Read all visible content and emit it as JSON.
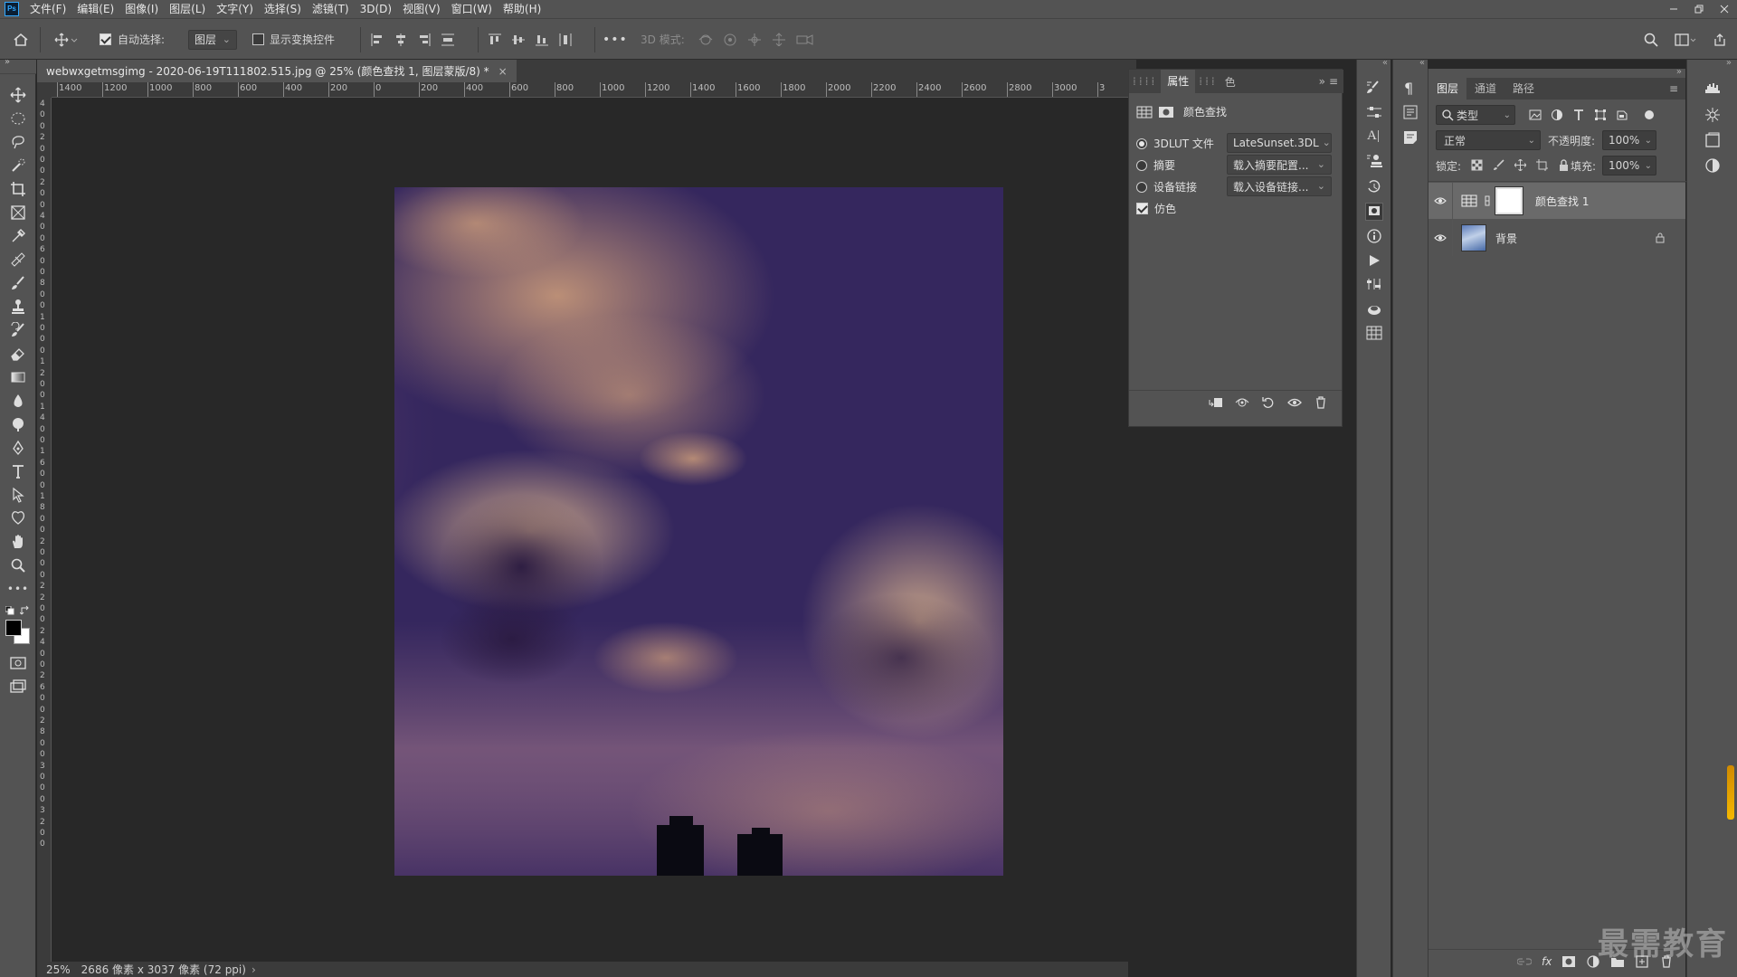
{
  "menubar": {
    "app_icon": "Ps",
    "items": [
      "文件(F)",
      "编辑(E)",
      "图像(I)",
      "图层(L)",
      "文字(Y)",
      "选择(S)",
      "滤镜(T)",
      "3D(D)",
      "视图(V)",
      "窗口(W)",
      "帮助(H)"
    ],
    "window_controls": [
      "minimize-icon",
      "restore-icon",
      "close-icon"
    ]
  },
  "options": {
    "auto_select_label": "自动选择:",
    "auto_select_checked": true,
    "auto_select_target": "图层",
    "show_transform_label": "显示变换控件",
    "show_transform_checked": false,
    "more": "•••",
    "mode3d_label": "3D 模式:"
  },
  "document": {
    "tab_title": "webwxgetmsgimg - 2020-06-19T111802.515.jpg @ 25% (颜色查找 1, 图层蒙版/8) *",
    "close": "×"
  },
  "rulers": {
    "h_ticks": [
      "1400",
      "1200",
      "1000",
      "800",
      "600",
      "400",
      "200",
      "0",
      "200",
      "400",
      "600",
      "800",
      "1000",
      "1200",
      "1400",
      "1600",
      "1800",
      "2000",
      "2200",
      "2400",
      "2600",
      "2800",
      "3000",
      "3"
    ],
    "v_ticks": [
      "4",
      "0",
      "0",
      "2",
      "0",
      "0",
      "0",
      "2",
      "0",
      "0",
      "4",
      "0",
      "0",
      "6",
      "0",
      "0",
      "8",
      "0",
      "0",
      "1",
      "0",
      "0",
      "0",
      "1",
      "2",
      "0",
      "0",
      "1",
      "4",
      "0",
      "0",
      "1",
      "6",
      "0",
      "0",
      "1",
      "8",
      "0",
      "0",
      "2",
      "0",
      "0",
      "0",
      "2",
      "2",
      "0",
      "0",
      "2",
      "4",
      "0",
      "0",
      "2",
      "6",
      "0",
      "0",
      "2",
      "8",
      "0",
      "0",
      "3",
      "0",
      "0",
      "0",
      "3",
      "2",
      "0",
      "0"
    ]
  },
  "status": {
    "zoom": "25%",
    "info": "2686 像素 x 3037 像素 (72 ppi)"
  },
  "properties": {
    "tabs": [
      "属性",
      "色"
    ],
    "active_tab": "属性",
    "header": "颜色查找",
    "rows": [
      {
        "type": "radio",
        "label": "3DLUT 文件",
        "selected": true,
        "value": "LateSunset.3DL"
      },
      {
        "type": "radio",
        "label": "摘要",
        "selected": false,
        "value": "载入摘要配置..."
      },
      {
        "type": "radio",
        "label": "设备链接",
        "selected": false,
        "value": "载入设备链接..."
      },
      {
        "type": "checkbox",
        "label": "仿色",
        "checked": true
      }
    ]
  },
  "layers_panel": {
    "tabs": [
      "图层",
      "通道",
      "路径"
    ],
    "active_tab": "图层",
    "filter_kind": "类型",
    "blend_mode": "正常",
    "opacity_label": "不透明度:",
    "opacity": "100%",
    "lock_label": "锁定:",
    "fill_label": "填充:",
    "fill": "100%",
    "layers": [
      {
        "name": "颜色查找 1",
        "visible": true,
        "selected": true,
        "type": "adjustment"
      },
      {
        "name": "背景",
        "visible": true,
        "selected": false,
        "type": "background",
        "locked": true
      }
    ]
  },
  "watermark": "最需教育",
  "colors": {
    "panel_bg": "#535353",
    "dark_bg": "#282828",
    "accent": "#31a8ff"
  }
}
